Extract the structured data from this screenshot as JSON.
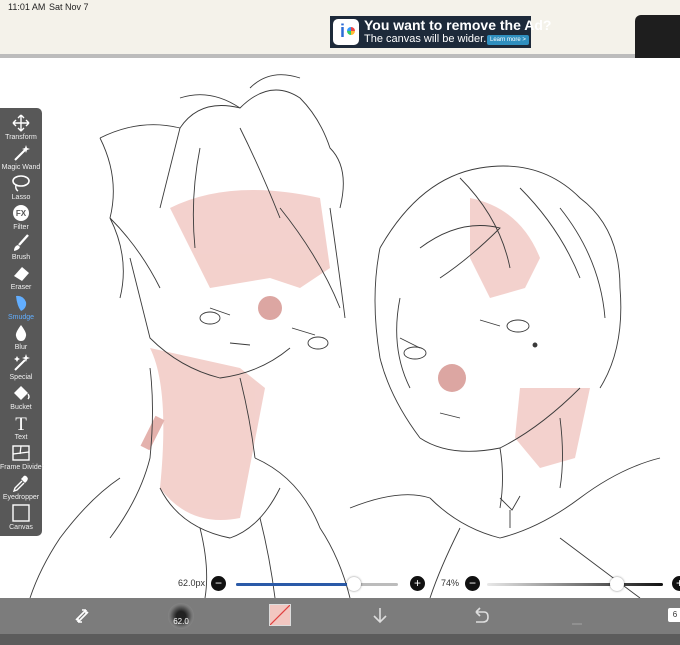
{
  "status_bar": {
    "time": "11:01 AM",
    "date": "Sat Nov 7"
  },
  "ad": {
    "logo_letter": "i",
    "headline": "You want to remove the Ad?",
    "subline": "The canvas will be wider.",
    "cta": "Learn more >"
  },
  "tools": [
    {
      "label": "Transform",
      "icon": "move-arrows-icon"
    },
    {
      "label": "Magic Wand",
      "icon": "magic-wand-icon"
    },
    {
      "label": "Lasso",
      "icon": "lasso-icon"
    },
    {
      "label": "Filter",
      "icon": "fx-icon"
    },
    {
      "label": "Brush",
      "icon": "brush-icon"
    },
    {
      "label": "Eraser",
      "icon": "eraser-icon"
    },
    {
      "label": "Smudge",
      "icon": "smudge-icon",
      "active": true
    },
    {
      "label": "Blur",
      "icon": "blur-drop-icon"
    },
    {
      "label": "Special",
      "icon": "special-sparkle-icon"
    },
    {
      "label": "Bucket",
      "icon": "bucket-icon"
    },
    {
      "label": "Text",
      "icon": "text-t-icon"
    },
    {
      "label": "Frame Divider",
      "icon": "frame-divider-icon"
    },
    {
      "label": "Eyedropper",
      "icon": "eyedropper-icon"
    },
    {
      "label": "Canvas",
      "icon": "canvas-square-icon"
    }
  ],
  "fx_text": "FX",
  "text_tool_glyph": "T",
  "brush_size": {
    "label": "62.0px",
    "value_fraction": 0.73
  },
  "opacity": {
    "label": "74%",
    "value_fraction": 0.74
  },
  "minus_glyph": "−",
  "plus_glyph": "+",
  "bottom_bar": {
    "brush_size_preview": "62.0",
    "selected_color": "#f2c7c1",
    "layer_count": "6"
  },
  "colors": {
    "accent": "#2a5aa8",
    "active_tool": "#55a8ff",
    "toolbar_bg": "#4a4a4a"
  }
}
